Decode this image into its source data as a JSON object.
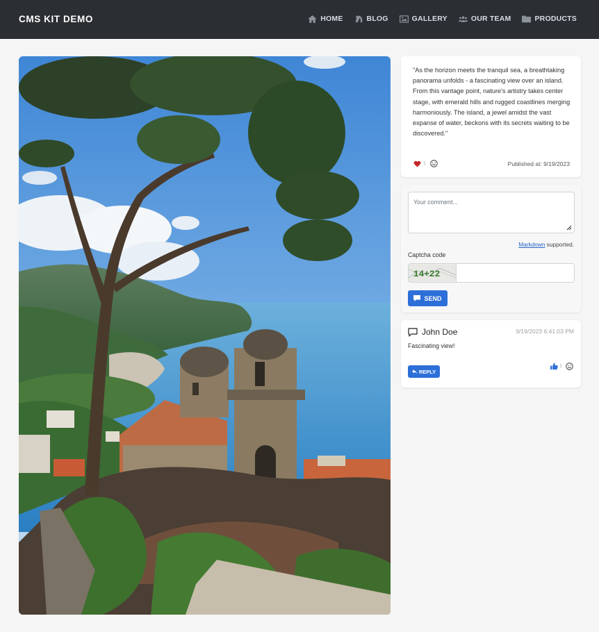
{
  "brand": "CMS KIT DEMO",
  "nav": [
    {
      "label": "HOME",
      "icon": "home-icon"
    },
    {
      "label": "BLOG",
      "icon": "blog-icon"
    },
    {
      "label": "GALLERY",
      "icon": "image-icon"
    },
    {
      "label": "OUR TEAM",
      "icon": "team-icon"
    },
    {
      "label": "PRODUCTS",
      "icon": "folder-icon"
    }
  ],
  "post": {
    "text": "\"As the horizon meets the tranquil sea, a breathtaking panorama unfolds - a fascinating view over an island. From this vantage point, nature's artistry takes center stage, with emerald hills and rugged coastlines merging harmoniously. The island, a jewel amidst the vast expanse of water, beckons with its secrets waiting to be discovered.\"",
    "like_count": "1",
    "published": "Published at: 9/19/2023"
  },
  "comment_form": {
    "placeholder": "Your comment...",
    "markdown_link": "Markdown",
    "markdown_suffix": " supported.",
    "captcha_label": "Captcha code",
    "captcha_text": "14+22",
    "send_label": "SEND"
  },
  "comment": {
    "author": "John Doe",
    "timestamp": "9/19/2023 6:41:03 PM",
    "text": "Fascinating view!",
    "reply_label": "REPLY",
    "like_count": "1"
  },
  "colors": {
    "navbar": "#2b2e33",
    "accent": "#2d6fd8",
    "heart": "#c62828"
  }
}
